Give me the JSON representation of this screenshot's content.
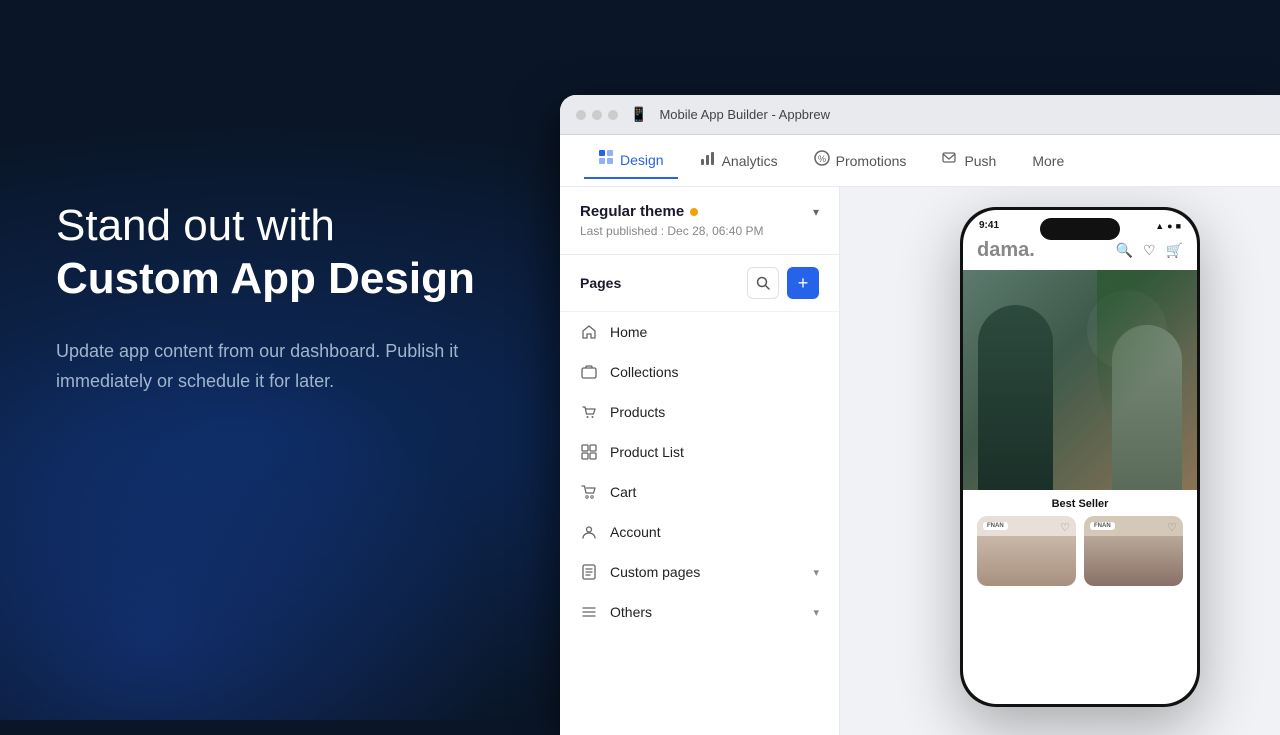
{
  "background": {
    "colors": {
      "primary": "#0a1628",
      "glow": "rgba(30,80,200,0.35)"
    }
  },
  "left_panel": {
    "headline_line1": "Stand out with",
    "headline_line2": "Custom App Design",
    "subtext": "Update app content from our dashboard. Publish it immediately or schedule it for later."
  },
  "browser": {
    "title": "Mobile App Builder - Appbrew",
    "favicon": "📱",
    "tabs": [
      {
        "id": "design",
        "label": "Design",
        "active": true,
        "icon": "design"
      },
      {
        "id": "analytics",
        "label": "Analytics",
        "active": false,
        "icon": "analytics"
      },
      {
        "id": "promotions",
        "label": "Promotions",
        "active": false,
        "icon": "promotions"
      },
      {
        "id": "push",
        "label": "Push",
        "active": false,
        "icon": "push"
      },
      {
        "id": "more",
        "label": "More",
        "active": false,
        "icon": "more"
      }
    ]
  },
  "sidebar": {
    "theme": {
      "name": "Regular theme",
      "dot_color": "#f59e0b",
      "last_published": "Last published : Dec 28, 06:40 PM"
    },
    "pages_label": "Pages",
    "search_button_label": "🔍",
    "add_button_label": "+",
    "nav_items": [
      {
        "id": "home",
        "label": "Home",
        "icon": "home",
        "has_chevron": false
      },
      {
        "id": "collections",
        "label": "Collections",
        "icon": "collections",
        "has_chevron": false
      },
      {
        "id": "products",
        "label": "Products",
        "icon": "products",
        "has_chevron": false
      },
      {
        "id": "product-list",
        "label": "Product List",
        "icon": "product-list",
        "has_chevron": false
      },
      {
        "id": "cart",
        "label": "Cart",
        "icon": "cart",
        "has_chevron": false
      },
      {
        "id": "account",
        "label": "Account",
        "icon": "account",
        "has_chevron": false
      },
      {
        "id": "custom-pages",
        "label": "Custom pages",
        "icon": "custom-pages",
        "has_chevron": true
      },
      {
        "id": "others",
        "label": "Others",
        "icon": "others",
        "has_chevron": true
      }
    ]
  },
  "phone": {
    "status_bar": {
      "time": "9:41",
      "icons": "▲ ● ■"
    },
    "logo": "dama.",
    "bestseller_label": "Best Seller",
    "product_brand": "FNAN"
  }
}
